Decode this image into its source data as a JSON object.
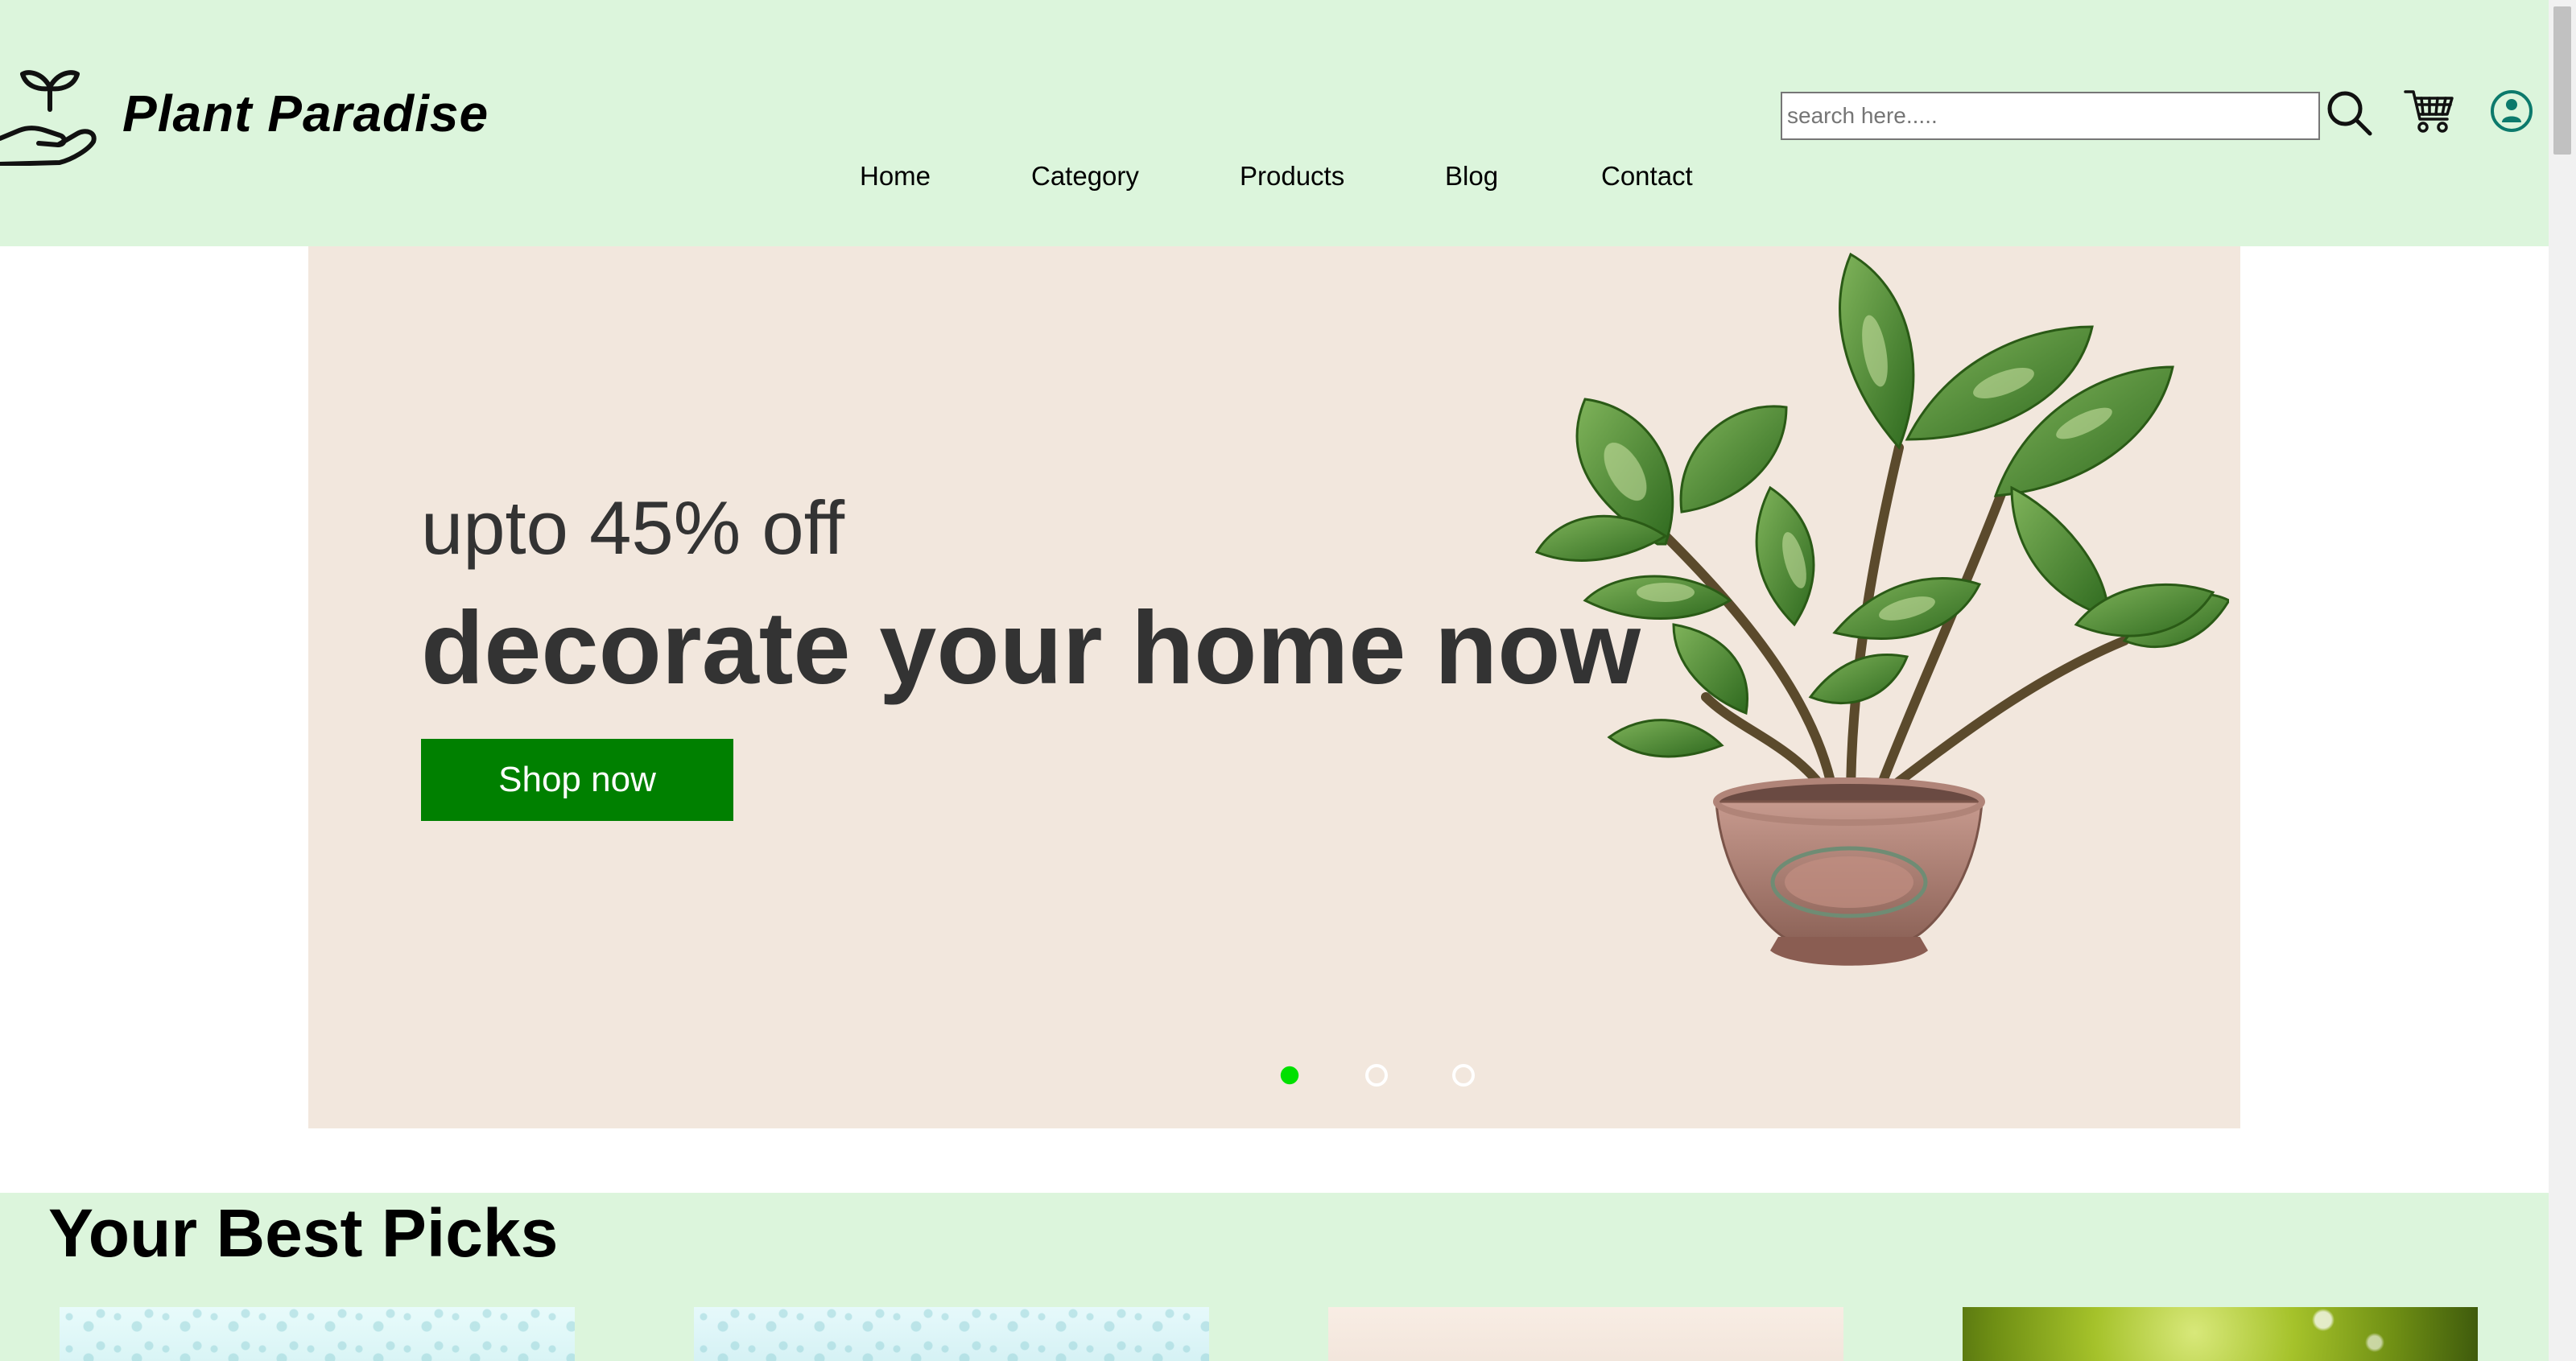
{
  "header": {
    "brand": "Plant Paradise",
    "logo_icon": "hand-sprout-icon",
    "nav": [
      "Home",
      "Category",
      "Products",
      "Blog",
      "Contact"
    ],
    "search_placeholder": "search here.....",
    "search_value": "",
    "icons": [
      "search-icon",
      "cart-icon",
      "user-icon"
    ]
  },
  "hero": {
    "subtitle": "upto 45% off",
    "title": "decorate your home now",
    "button_label": "Shop now",
    "slide_count": 3,
    "active_slide": 1,
    "image": "potted-plant"
  },
  "best_picks": {
    "title": "Your Best Picks",
    "cards": [
      "card-1",
      "card-2",
      "card-3",
      "card-4"
    ]
  },
  "colors": {
    "header_bg": "#dcf5dc",
    "hero_bg": "#f2e7dd",
    "button_bg": "#008000",
    "active_dot": "#00e000",
    "text_dark": "#333333"
  }
}
